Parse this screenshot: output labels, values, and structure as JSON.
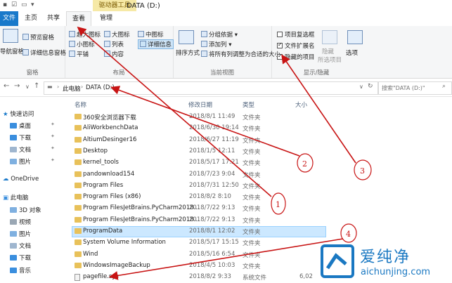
{
  "window": {
    "title": "DATA (D:)",
    "context_tab": "驱动器工具"
  },
  "tabs": [
    "文件",
    "主页",
    "共享",
    "查看",
    "管理"
  ],
  "ribbon": {
    "pane_group": {
      "label": "窗格",
      "nav_pane": "导航窗格",
      "preview": "预览窗格",
      "details": "详细信息窗格"
    },
    "layout_group": {
      "label": "布局",
      "items": [
        "超大图标",
        "大图标",
        "中图标",
        "小图标",
        "列表",
        "详细信息",
        "平铺",
        "内容"
      ]
    },
    "current_view_group": {
      "label": "当前视图",
      "sort": "排序方式",
      "group_by": "分组依据",
      "add_column": "添加列",
      "fit_columns": "将所有列调整为合适的大小"
    },
    "showhide_group": {
      "label": "显示/隐藏",
      "item_checkbox": "项目复选框",
      "file_ext": "文件扩展名",
      "hidden_items": "隐藏的项目",
      "hide_selected": "隐藏",
      "hide_selected_sub": "所选项目",
      "options": "选项"
    }
  },
  "address": {
    "path": [
      "此电脑",
      "DATA (D:)"
    ],
    "search_placeholder": "搜索\"DATA (D:)\""
  },
  "nav_pane": [
    "快速访问",
    "桌面",
    "下载",
    "文档",
    "图片",
    "OneDrive",
    "此电脑",
    "3D 对象",
    "视频",
    "图片",
    "文档",
    "下载",
    "音乐"
  ],
  "columns": [
    "名称",
    "修改日期",
    "类型",
    "大小"
  ],
  "files": [
    {
      "name": "360安全浏览器下载",
      "date": "2018/8/1 11:49",
      "type": "文件夹",
      "size": "",
      "kind": "folder"
    },
    {
      "name": "AliWorkbenchData",
      "date": "2018/6/30 19:14",
      "type": "文件夹",
      "size": "",
      "kind": "folder"
    },
    {
      "name": "AltiumDesinger16",
      "date": "2018/6/27 11:19",
      "type": "文件夹",
      "size": "",
      "kind": "folder"
    },
    {
      "name": "Desktop",
      "date": "2018/1/5 12:11",
      "type": "文件夹",
      "size": "",
      "kind": "folder"
    },
    {
      "name": "kernel_tools",
      "date": "2018/5/17 17:21",
      "type": "文件夹",
      "size": "",
      "kind": "folder"
    },
    {
      "name": "pandownload154",
      "date": "2018/7/23 9:04",
      "type": "文件夹",
      "size": "",
      "kind": "folder"
    },
    {
      "name": "Program Files",
      "date": "2018/7/31 12:50",
      "type": "文件夹",
      "size": "",
      "kind": "folder"
    },
    {
      "name": "Program Files (x86)",
      "date": "2018/8/2 8:10",
      "type": "文件夹",
      "size": "",
      "kind": "folder"
    },
    {
      "name": "Program FilesJetBrains.PyCharm2018...",
      "date": "2018/7/22 9:13",
      "type": "文件夹",
      "size": "",
      "kind": "folder"
    },
    {
      "name": "Program FilesJetBrains.PyCharm2018...",
      "date": "2018/7/22 9:13",
      "type": "文件夹",
      "size": "",
      "kind": "folder"
    },
    {
      "name": "ProgramData",
      "date": "2018/8/1 12:02",
      "type": "文件夹",
      "size": "",
      "kind": "folder",
      "selected": true
    },
    {
      "name": "System Volume Information",
      "date": "2018/5/17 15:15",
      "type": "文件夹",
      "size": "",
      "kind": "folder"
    },
    {
      "name": "Wind",
      "date": "2018/5/16 6:54",
      "type": "文件夹",
      "size": "",
      "kind": "folder"
    },
    {
      "name": "WindowsImageBackup",
      "date": "2018/4/5 10:03",
      "type": "文件夹",
      "size": "",
      "kind": "folder"
    },
    {
      "name": "pagefile.sys",
      "date": "2018/8/2 9:33",
      "type": "系统文件",
      "size": "6,02",
      "kind": "sys"
    }
  ],
  "annotations": [
    "1",
    "2",
    "3",
    "4"
  ],
  "watermark": {
    "cn": "爱纯净",
    "en": "aichunjing.com"
  },
  "colors": {
    "annotation": "#c81414",
    "file_tab": "#1979ca",
    "selection": "#cce8ff",
    "context_tab": "#f6e9a6"
  }
}
